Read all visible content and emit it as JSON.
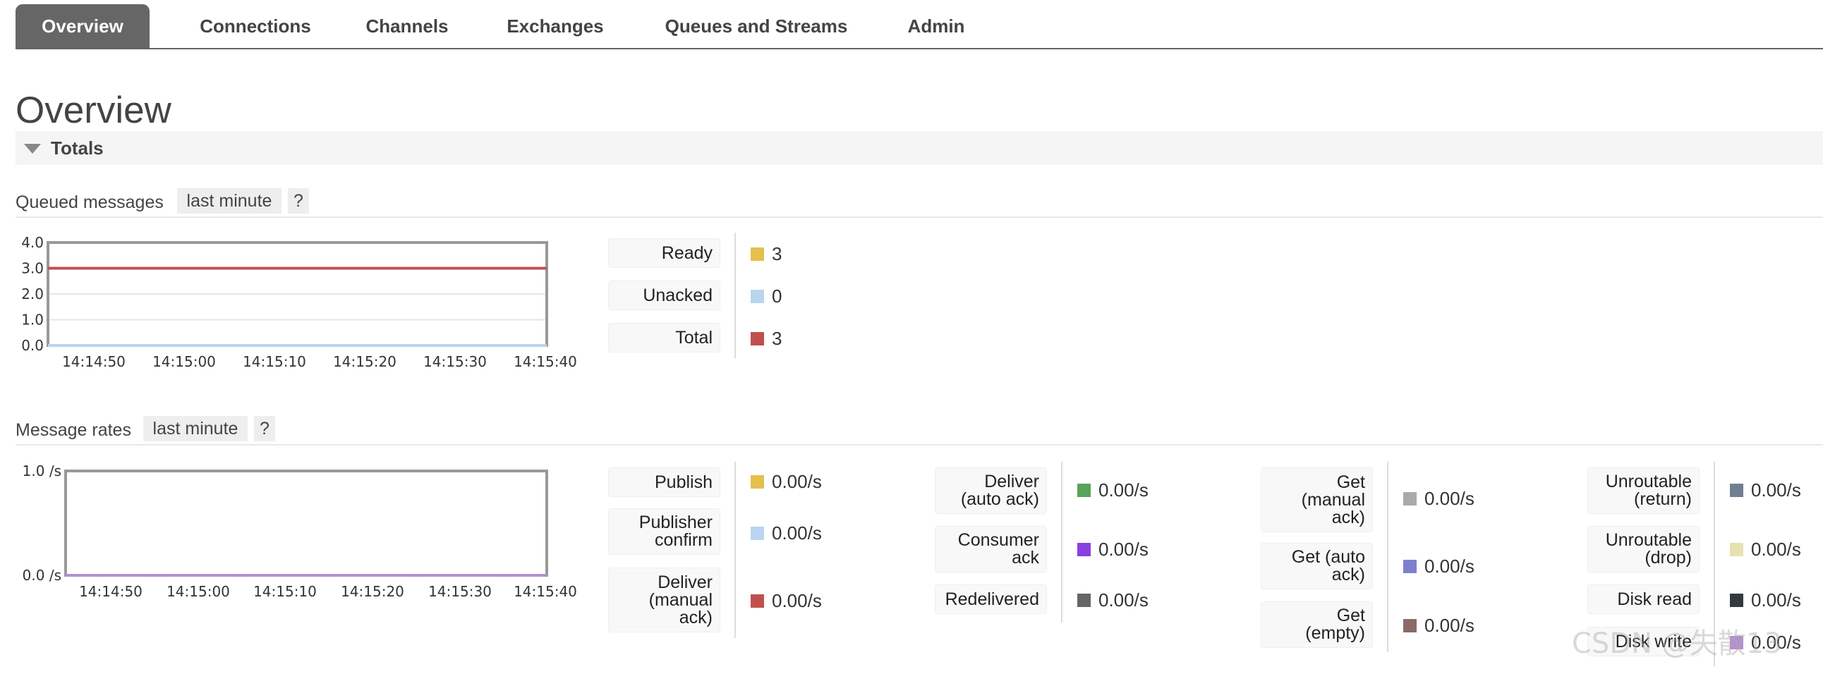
{
  "tabs": [
    "Overview",
    "Connections",
    "Channels",
    "Exchanges",
    "Queues and Streams",
    "Admin"
  ],
  "page_title": "Overview",
  "section_totals": "Totals",
  "help_chip": "?",
  "queued": {
    "title": "Queued messages",
    "range": "last minute",
    "legend": [
      {
        "label": "Ready",
        "value": "3",
        "color": "#e4c04f"
      },
      {
        "label": "Unacked",
        "value": "0",
        "color": "#b9d5ef"
      },
      {
        "label": "Total",
        "value": "3",
        "color": "#c0504d"
      }
    ]
  },
  "rates": {
    "title": "Message rates",
    "range": "last minute",
    "legend_groups": [
      [
        {
          "label": "Publish",
          "value": "0.00/s",
          "color": "#e4c04f"
        },
        {
          "label": "Publisher\nconfirm",
          "value": "0.00/s",
          "color": "#b9d5ef"
        },
        {
          "label": "Deliver\n(manual\nack)",
          "value": "0.00/s",
          "color": "#c0504d"
        }
      ],
      [
        {
          "label": "Deliver\n(auto ack)",
          "value": "0.00/s",
          "color": "#5aa35a"
        },
        {
          "label": "Consumer\nack",
          "value": "0.00/s",
          "color": "#8a3fe0"
        },
        {
          "label": "Redelivered",
          "value": "0.00/s",
          "color": "#666666"
        }
      ],
      [
        {
          "label": "Get\n(manual\nack)",
          "value": "0.00/s",
          "color": "#aaaaaa"
        },
        {
          "label": "Get (auto\nack)",
          "value": "0.00/s",
          "color": "#7f7fd0"
        },
        {
          "label": "Get\n(empty)",
          "value": "0.00/s",
          "color": "#8c6a6a"
        }
      ],
      [
        {
          "label": "Unroutable\n(return)",
          "value": "0.00/s",
          "color": "#6f7f8f"
        },
        {
          "label": "Unroutable\n(drop)",
          "value": "0.00/s",
          "color": "#e6e2b0"
        },
        {
          "label": "Disk read",
          "value": "0.00/s",
          "color": "#333a40"
        },
        {
          "label": "Disk write",
          "value": "0.00/s",
          "color": "#b58fd0"
        }
      ]
    ]
  },
  "chart_data": [
    {
      "type": "line",
      "ylim": [
        0,
        4
      ],
      "yticks": [
        "4.0",
        "3.0",
        "2.0",
        "1.0",
        "0.0"
      ],
      "xticks": [
        "14:14:50",
        "14:15:00",
        "14:15:10",
        "14:15:20",
        "14:15:30",
        "14:15:40"
      ],
      "series": [
        {
          "name": "Ready",
          "color": "#e4c04f",
          "values": [
            3,
            3,
            3,
            3,
            3,
            3
          ]
        },
        {
          "name": "Unacked",
          "color": "#b9d5ef",
          "values": [
            0,
            0,
            0,
            0,
            0,
            0
          ]
        },
        {
          "name": "Total",
          "color": "#c0504d",
          "values": [
            3,
            3,
            3,
            3,
            3,
            3
          ]
        }
      ],
      "grid": true
    },
    {
      "type": "line",
      "ylim": [
        0,
        1
      ],
      "yticks": [
        "1.0 /s",
        "0.0 /s"
      ],
      "xticks": [
        "14:14:50",
        "14:15:00",
        "14:15:10",
        "14:15:20",
        "14:15:30",
        "14:15:40"
      ],
      "series": [
        {
          "name": "Disk write",
          "color": "#b58fd0",
          "values": [
            0,
            0,
            0,
            0,
            0,
            0
          ]
        }
      ],
      "grid": false
    }
  ],
  "watermark": "CSDN @失散13"
}
